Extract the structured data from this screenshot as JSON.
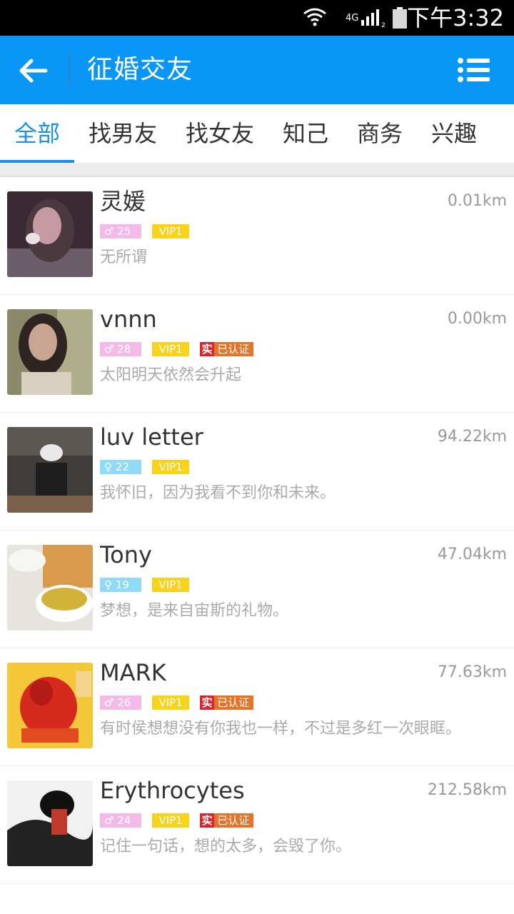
{
  "status_bar": {
    "network": "4G",
    "time": "下午3:32",
    "icons": [
      "wifi-icon",
      "signal-icon",
      "battery-icon"
    ]
  },
  "top_bar": {
    "title": "征婚交友",
    "back_icon": "back-arrow-icon",
    "menu_icon": "list-menu-icon",
    "color": "#0a96f7"
  },
  "tabs": [
    {
      "label": "全部",
      "active": true
    },
    {
      "label": "找男友",
      "active": false
    },
    {
      "label": "找女友",
      "active": false
    },
    {
      "label": "知己",
      "active": false
    },
    {
      "label": "商务",
      "active": false
    },
    {
      "label": "兴趣",
      "active": false
    }
  ],
  "users": [
    {
      "name": "灵媛",
      "distance": "0.01km",
      "gender_symbol": "♂",
      "gender_style": "female",
      "age": "25",
      "vip": "VIP1",
      "verified": false,
      "signature": "无所谓"
    },
    {
      "name": "vnnn",
      "distance": "0.00km",
      "gender_symbol": "♂",
      "gender_style": "female",
      "age": "28",
      "vip": "VIP1",
      "verified": true,
      "verified_mark": "实",
      "verified_label": "已认证",
      "signature": "太阳明天依然会升起"
    },
    {
      "name": "luv letter",
      "distance": "94.22km",
      "gender_symbol": "♀",
      "gender_style": "male",
      "age": "22",
      "vip": "VIP1",
      "verified": false,
      "signature": "我怀旧，因为我看不到你和未来。"
    },
    {
      "name": "Tony",
      "distance": "47.04km",
      "gender_symbol": "♀",
      "gender_style": "male",
      "age": "19",
      "vip": "VIP1",
      "verified": false,
      "signature": "梦想，是来自宙斯的礼物。"
    },
    {
      "name": "MARK",
      "distance": "77.63km",
      "gender_symbol": "♂",
      "gender_style": "female",
      "age": "26",
      "vip": "VIP1",
      "verified": true,
      "verified_mark": "实",
      "verified_label": "已认证",
      "signature": "有时侯想想没有你我也一样，不过是多红一次眼眶。"
    },
    {
      "name": "Erythrocytes",
      "distance": "212.58km",
      "gender_symbol": "♂",
      "gender_style": "female",
      "age": "24",
      "vip": "VIP1",
      "verified": true,
      "verified_mark": "实",
      "verified_label": "已认证",
      "signature": "记住一句话，想的太多，会毁了你。"
    }
  ]
}
